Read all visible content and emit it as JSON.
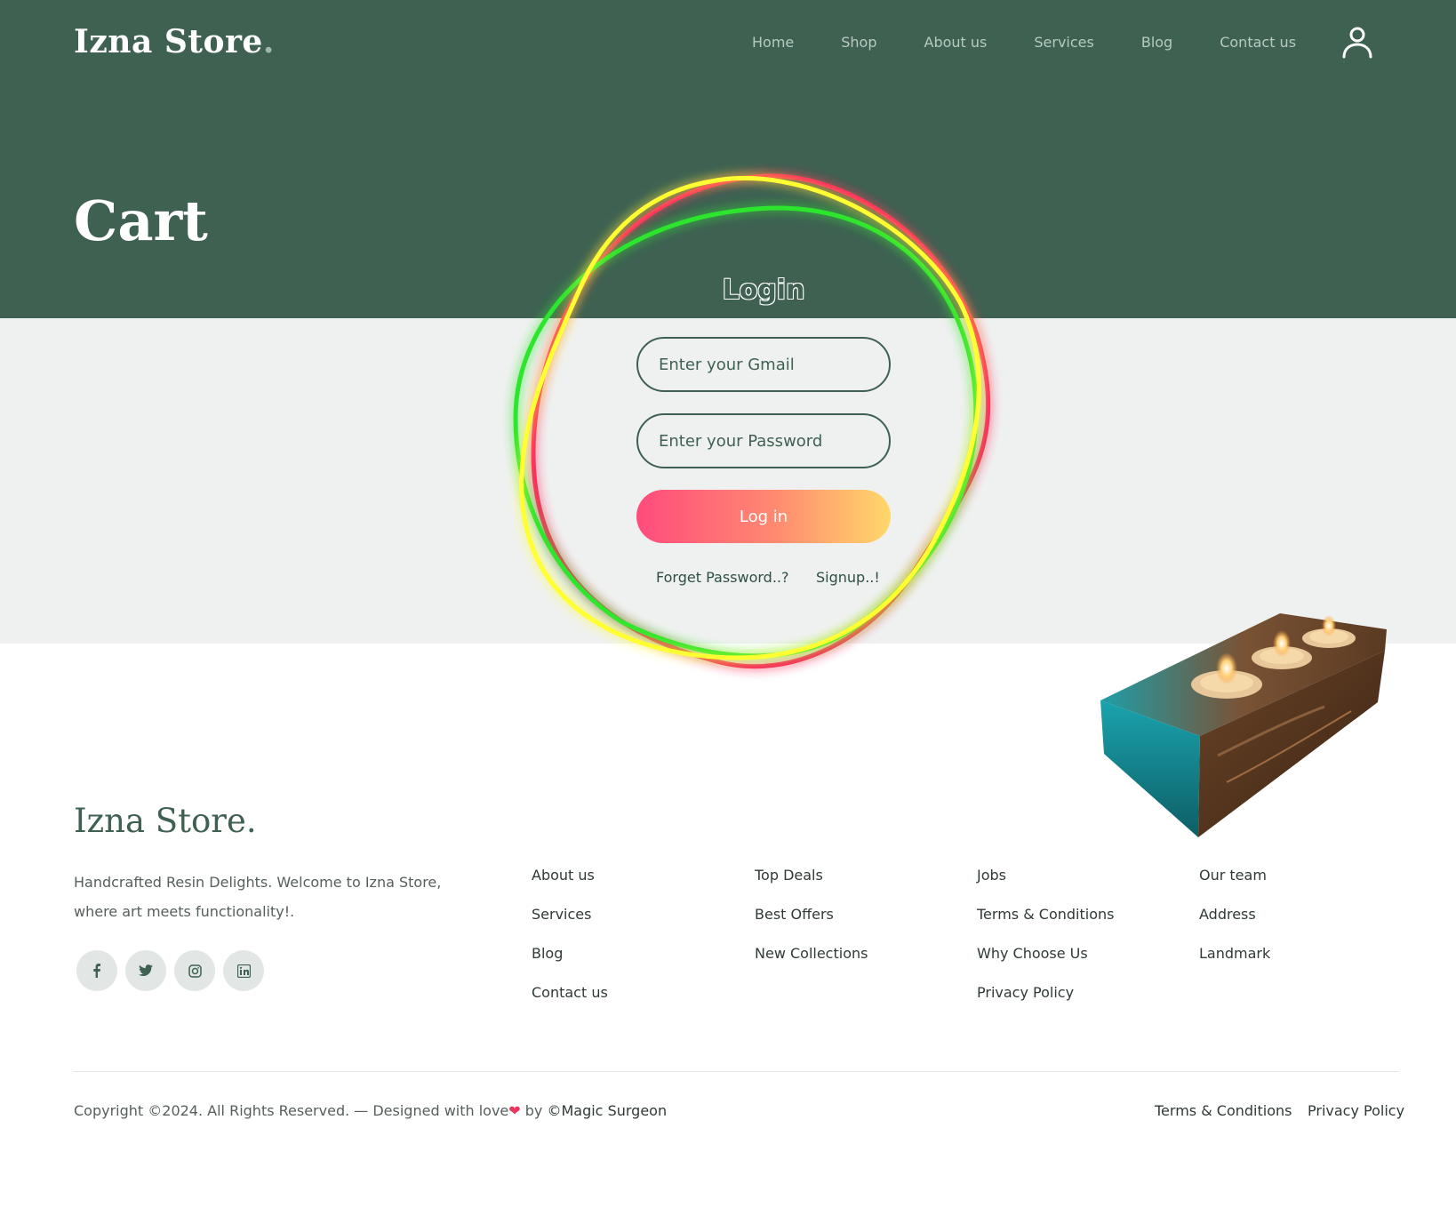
{
  "header": {
    "brand": "Izna Store",
    "brand_dot": ".",
    "nav": [
      "Home",
      "Shop",
      "About us",
      "Services",
      "Blog",
      "Contact us"
    ],
    "user_icon": "user-icon"
  },
  "hero": {
    "title": "Cart"
  },
  "login": {
    "title": "Login",
    "email_placeholder": "Enter your Gmail",
    "password_placeholder": "Enter your Password",
    "button": "Log in",
    "forget": "Forget Password..?",
    "signup": "Signup..!",
    "ring_colors": [
      "#ff2b5e",
      "#2ee52e",
      "#ffff33"
    ]
  },
  "footer": {
    "brand": "Izna Store.",
    "description": "Handcrafted Resin Delights. Welcome to Izna Store, where art meets functionality!.",
    "socials": [
      "facebook-icon",
      "twitter-icon",
      "instagram-icon",
      "linkedin-icon"
    ],
    "columns": [
      [
        "About us",
        "Services",
        "Blog",
        "Contact us"
      ],
      [
        "Top Deals",
        "Best Offers",
        "New Collections"
      ],
      [
        "Jobs",
        "Terms & Conditions",
        "Why Choose Us",
        "Privacy Policy"
      ],
      [
        "Our team",
        "Address",
        "Landmark"
      ]
    ],
    "copyright": "Copyright ©2024. All Rights Reserved. — Designed with love",
    "heart": "❤",
    "by": " by ",
    "author": "©Magic Surgeon",
    "legal_terms": "Terms & Conditions",
    "legal_privacy": "Privacy Policy"
  },
  "colors": {
    "primary": "#3e6152",
    "band": "#eff1f0",
    "button_gradient": [
      "#ff4b7d",
      "#ffd86a"
    ]
  }
}
